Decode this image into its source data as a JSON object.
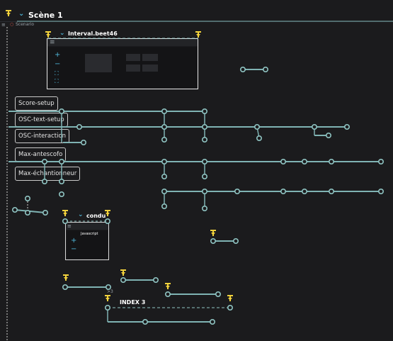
{
  "scene": {
    "title": "Scène 1",
    "scenario_label": "Scenario"
  },
  "interval": {
    "label": "Interval.beet46"
  },
  "labels": [
    {
      "key": "score",
      "text": "Score-setup"
    },
    {
      "key": "osc_text",
      "text": "OSC-text-setup"
    },
    {
      "key": "osc_inter",
      "text": "OSC-interaction"
    },
    {
      "key": "max_antes",
      "text": "Max-antescofo"
    },
    {
      "key": "max_ech",
      "text": "Max-échantionneur"
    }
  ],
  "conduit": {
    "label": "condu",
    "inner_label": "Javascript"
  },
  "index": {
    "label": "INDEX 3",
    "counter": "3"
  },
  "colors": {
    "line": "#7fb3b3",
    "node": "#8fc4c2",
    "trigger": "#f2d23c",
    "accent": "#4fb6d8"
  }
}
